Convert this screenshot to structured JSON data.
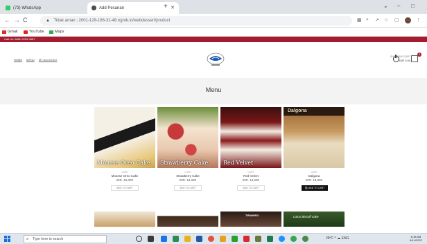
{
  "browser": {
    "tabs": [
      {
        "title": "(73) WhatsApp",
        "favicon_color": "#25d366"
      },
      {
        "title": "Add Pesanan",
        "favicon_color": "#4a4a4a",
        "active": true
      }
    ],
    "new_tab": "+",
    "window_controls": [
      "⌄",
      "–",
      "□"
    ],
    "nav": {
      "back": "←",
      "forward": "→",
      "reload": "C"
    },
    "address": {
      "warning": "Tidak aman",
      "url": "2001-128-186-32-48.ngrok.io/webdessert/product"
    },
    "bookmarks": [
      {
        "label": "Gmail",
        "color": "#d93025"
      },
      {
        "label": "YouTube",
        "color": "#e62117"
      },
      {
        "label": "Maps",
        "color": "#34a853"
      }
    ]
  },
  "site": {
    "topbar_text": "Call Us: 0881-2223-4587",
    "nav": [
      "HOME",
      "MENU",
      "MY ACCOUNT"
    ],
    "cart": {
      "label": "SHOPPING CART",
      "total": "IDR 0.00",
      "count": "0"
    },
    "page_title": "Menu",
    "accent": "#a51c30",
    "products": [
      {
        "image_caption": "Mousse Oreo Cake",
        "category": "CAKE",
        "name": "Mousse Oreo Cake",
        "price": "IDR. 15,000",
        "button": "ADD TO CART",
        "image_colors": [
          "#1a1a1a",
          "#f5f0e6",
          "#e8c77a"
        ]
      },
      {
        "image_caption": "Strawberry Cake",
        "category": "CAKE",
        "name": "Strawberry Cake",
        "price": "IDR. 18,000",
        "button": "ADD TO CART",
        "image_colors": [
          "#c73a3a",
          "#f4e3cf",
          "#6b8f3a"
        ]
      },
      {
        "image_caption": "Red Velvet",
        "category": "CAKE",
        "name": "Red Velvet",
        "price": "IDR. 15,000",
        "button": "ADD TO CART",
        "image_colors": [
          "#7a1616",
          "#f2ebe2",
          "#3a1010"
        ]
      },
      {
        "image_caption": "Dalgona",
        "category": "CAKE",
        "name": "Dalgona",
        "price": "IDR. 18,000",
        "button": "ADD TO CART",
        "image_colors": [
          "#a87540",
          "#e9dcc0",
          "#2a1a10"
        ]
      }
    ],
    "row2_captions": [
      "",
      "",
      "TIRAMISU",
      "Lotus Biscoff cake"
    ]
  },
  "taskbar": {
    "search_placeholder": "Type here to search",
    "tray": "29°C  ^ ☁ ENG",
    "time": "8:18 AM",
    "date": "6/14/2022"
  }
}
